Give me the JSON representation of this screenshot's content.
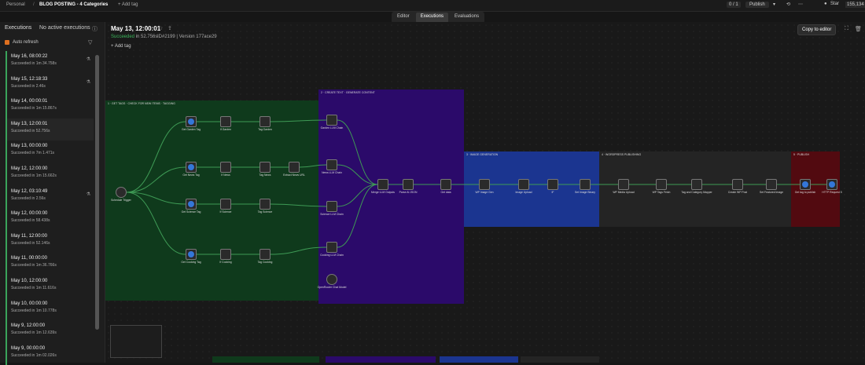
{
  "topbar": {
    "workspace": "Personal",
    "workflow": "BLOG POSTING - 4 Categories",
    "add_tag": "+ Add tag",
    "tabs": [
      {
        "label": "Editor"
      },
      {
        "label": "Executions"
      },
      {
        "label": "Evaluations"
      }
    ],
    "counter": "0 / 1",
    "publish": "Publish",
    "github_label": "Star",
    "github_count": "155,134"
  },
  "sidebar": {
    "title": "Executions",
    "active": "No active executions",
    "auto_refresh": "Auto refresh",
    "executions": [
      {
        "date": "May 16, 08:00:22",
        "status": "Succeeded in 1m 34.758s",
        "icon": "flask-icon"
      },
      {
        "date": "May 15, 12:18:33",
        "status": "Succeeded in 2.46s",
        "icon": "flask-icon"
      },
      {
        "date": "May 14, 00:00:01",
        "status": "Succeeded in 1m 15.867s",
        "icon": ""
      },
      {
        "date": "May 13, 12:00:01",
        "status": "Succeeded in 52.756s",
        "icon": ""
      },
      {
        "date": "May 13, 00:00:00",
        "status": "Succeeded in 7m 1.471s",
        "icon": ""
      },
      {
        "date": "May 12, 12:00:00",
        "status": "Succeeded in 1m 15.662s",
        "icon": ""
      },
      {
        "date": "May 12, 03:10:49",
        "status": "Succeeded in 2.56s",
        "icon": "flask-icon"
      },
      {
        "date": "May 12, 00:00:00",
        "status": "Succeeded in 58.438s",
        "icon": ""
      },
      {
        "date": "May 11, 12:00:00",
        "status": "Succeeded in 52.146s",
        "icon": ""
      },
      {
        "date": "May 11, 00:00:00",
        "status": "Succeeded in 1m 36.766s",
        "icon": ""
      },
      {
        "date": "May 10, 12:00:00",
        "status": "Succeeded in 1m 11.616s",
        "icon": ""
      },
      {
        "date": "May 10, 00:00:00",
        "status": "Succeeded in 1m 10.778s",
        "icon": ""
      },
      {
        "date": "May 9, 12:00:00",
        "status": "Succeeded in 1m 12.639s",
        "icon": ""
      },
      {
        "date": "May 9, 00:00:00",
        "status": "Succeeded in 1m 02.026s",
        "icon": ""
      }
    ]
  },
  "execution": {
    "title": "May 13, 12:00:01",
    "status": "Succeeded",
    "duration": "in 52.756s",
    "id": "ID#2199",
    "version": "Version 177ace29",
    "add_tag": "Add tag",
    "copy_button": "Copy to editor"
  },
  "canvas": {
    "nodes": [
      {
        "label": "Schedule Trigger",
        "name": "schedule-trigger-node"
      },
      {
        "label": "Get Garden Tag",
        "name": "get-garden-tag-node"
      },
      {
        "label": "Get News Tag",
        "name": "get-news-tag-node"
      },
      {
        "label": "Get Science Tag",
        "name": "get-science-tag-node"
      },
      {
        "label": "Get Cooking Tag",
        "name": "get-cooking-tag-node"
      },
      {
        "label": "If Garden",
        "name": "if-garden-node"
      },
      {
        "label": "If News",
        "name": "if-news-node"
      },
      {
        "label": "If Science",
        "name": "if-science-node"
      },
      {
        "label": "If Cooking",
        "name": "if-cooking-node"
      },
      {
        "label": "Tag Garden",
        "name": "tag-garden-node"
      },
      {
        "label": "Tag News",
        "name": "tag-news-node"
      },
      {
        "label": "Tag Science",
        "name": "tag-science-node"
      },
      {
        "label": "Tag Cooking",
        "name": "tag-cooking-node"
      },
      {
        "label": "Extract News URL",
        "name": "extract-news-url-node"
      },
      {
        "label": "Garden LLM Chain",
        "name": "garden-llm-node"
      },
      {
        "label": "News LLM Chain",
        "name": "news-llm-node"
      },
      {
        "label": "Science LLM Chain",
        "name": "science-llm-node"
      },
      {
        "label": "Cooking LLM Chain",
        "name": "cooking-llm-node"
      },
      {
        "label": "OpenRouter Chat Model",
        "name": "openrouter-model-node"
      },
      {
        "label": "Merge LLM Outputs",
        "name": "merge-outputs-node"
      },
      {
        "label": "Parse AI JSON",
        "name": "parse-json-node"
      },
      {
        "label": "Get data",
        "name": "get-data-node"
      },
      {
        "label": "WP Image Gen",
        "name": "wp-image-gen-node"
      },
      {
        "label": "Image Upload",
        "name": "image-upload-node"
      },
      {
        "label": "IF",
        "name": "if-node"
      },
      {
        "label": "Set Image Binary",
        "name": "set-image-binary-node"
      },
      {
        "label": "WP Media Upload",
        "name": "wp-media-upload-node"
      },
      {
        "label": "WP Tags Fetch",
        "name": "wp-tags-fetch-node"
      },
      {
        "label": "Tag and Category Mapper",
        "name": "tag-category-mapper-node"
      },
      {
        "label": "Create WP Post",
        "name": "create-wp-post-node"
      },
      {
        "label": "Set Featured Image",
        "name": "set-featured-image-node"
      },
      {
        "label": "Get tag to publish",
        "name": "get-tag-publish-node"
      },
      {
        "label": "HTTP Request 5",
        "name": "http-request-node"
      }
    ]
  }
}
